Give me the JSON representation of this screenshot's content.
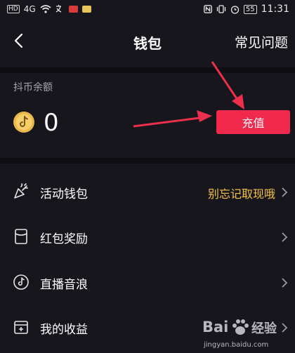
{
  "status_bar": {
    "hd_tag": "HD",
    "signal": "4G",
    "battery": "55",
    "time": "11:31"
  },
  "header": {
    "title": "钱包",
    "faq": "常见问题"
  },
  "balance": {
    "label": "抖币余额",
    "value": "0",
    "recharge_label": "充值"
  },
  "menu": {
    "activity_wallet": {
      "label": "活动钱包",
      "hint": "别忘记取现哦"
    },
    "red_packet": {
      "label": "红包奖励"
    },
    "live_wave": {
      "label": "直播音浪"
    },
    "my_earnings": {
      "label": "我的收益"
    }
  },
  "watermark": {
    "brand": "Bai",
    "brand2": "经验",
    "site": "jingyan.baidu.com"
  },
  "colors": {
    "background": "#17161d",
    "accent": "#f0294d",
    "hint": "#f4c342"
  }
}
